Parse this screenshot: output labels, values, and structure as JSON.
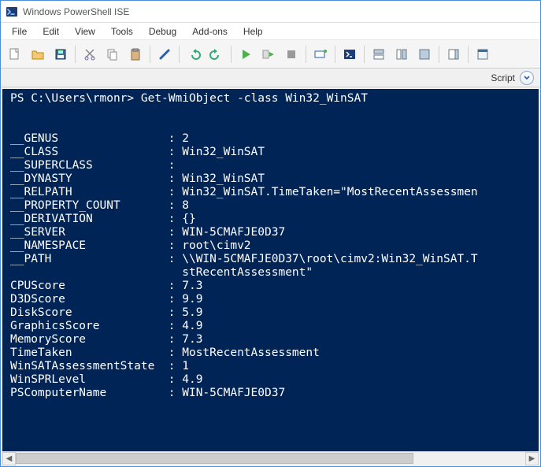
{
  "titlebar": {
    "title": "Windows PowerShell ISE"
  },
  "menu": {
    "items": [
      "File",
      "Edit",
      "View",
      "Tools",
      "Debug",
      "Add-ons",
      "Help"
    ]
  },
  "tabs": {
    "script_label": "Script"
  },
  "console": {
    "prompt": "PS C:\\Users\\rmonr> ",
    "command": "Get-WmiObject -class Win32_WinSAT",
    "lines": [
      {
        "k": "__GENUS",
        "v": "2"
      },
      {
        "k": "__CLASS",
        "v": "Win32_WinSAT"
      },
      {
        "k": "__SUPERCLASS",
        "v": ""
      },
      {
        "k": "__DYNASTY",
        "v": "Win32_WinSAT"
      },
      {
        "k": "__RELPATH",
        "v": "Win32_WinSAT.TimeTaken=\"MostRecentAssessmen"
      },
      {
        "k": "__PROPERTY_COUNT",
        "v": "8"
      },
      {
        "k": "__DERIVATION",
        "v": "{}"
      },
      {
        "k": "__SERVER",
        "v": "WIN-5CMAFJE0D37"
      },
      {
        "k": "__NAMESPACE",
        "v": "root\\cimv2"
      },
      {
        "k": "__PATH",
        "v": "\\\\WIN-5CMAFJE0D37\\root\\cimv2:Win32_WinSAT.T"
      },
      {
        "k": "",
        "v": "stRecentAssessment\""
      },
      {
        "k": "CPUScore",
        "v": "7.3"
      },
      {
        "k": "D3DScore",
        "v": "9.9"
      },
      {
        "k": "DiskScore",
        "v": "5.9"
      },
      {
        "k": "GraphicsScore",
        "v": "4.9"
      },
      {
        "k": "MemoryScore",
        "v": "7.3"
      },
      {
        "k": "TimeTaken",
        "v": "MostRecentAssessment"
      },
      {
        "k": "WinSATAssessmentState",
        "v": "1"
      },
      {
        "k": "WinSPRLevel",
        "v": "4.9"
      },
      {
        "k": "PSComputerName",
        "v": "WIN-5CMAFJE0D37"
      }
    ]
  }
}
